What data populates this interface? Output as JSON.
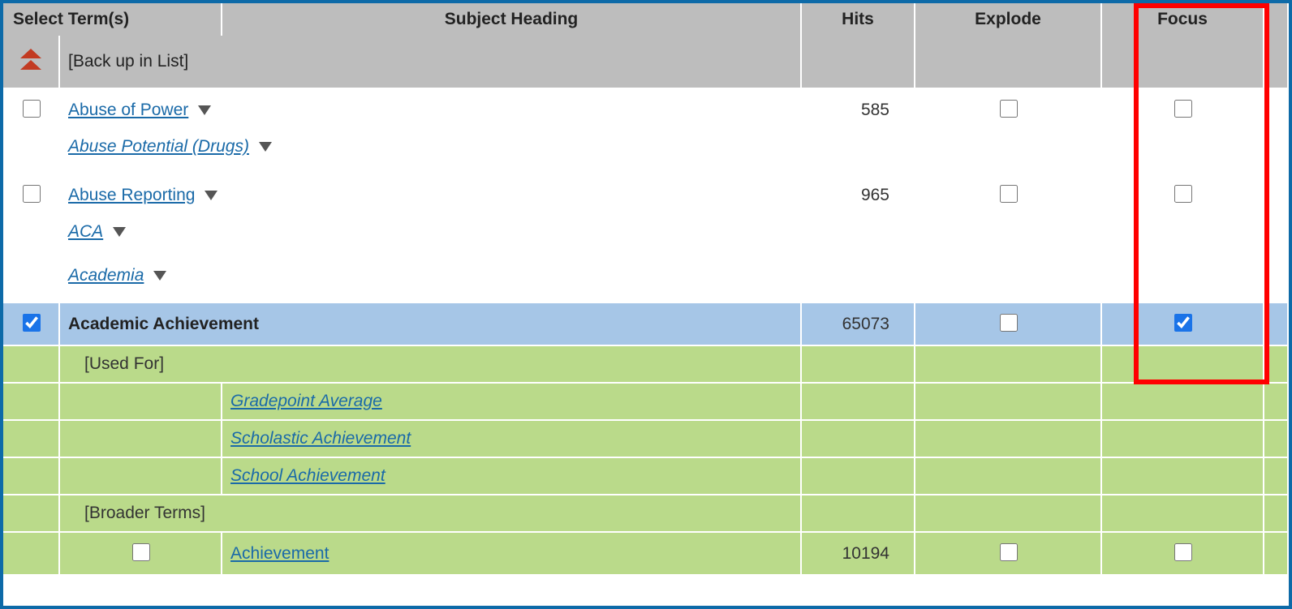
{
  "headers": {
    "select": "Select Term(s)",
    "subject": "Subject Heading",
    "hits": "Hits",
    "explode": "Explode",
    "focus": "Focus"
  },
  "backup_label": "[Back up in List]",
  "terms": {
    "abuse_of_power": {
      "label": "Abuse of Power",
      "hits": "585"
    },
    "abuse_potential": {
      "label": "Abuse Potential (Drugs)"
    },
    "abuse_reporting": {
      "label": "Abuse Reporting",
      "hits": "965"
    },
    "aca": {
      "label": "ACA"
    },
    "academia": {
      "label": "Academia"
    },
    "academic_achievement": {
      "label": "Academic Achievement",
      "hits": "65073"
    }
  },
  "used_for_label": "[Used For]",
  "used_for": {
    "gpa": "Gradepoint Average",
    "scholastic": "Scholastic Achievement",
    "school": "School Achievement"
  },
  "broader_label": "[Broader Terms]",
  "broader": {
    "achievement": {
      "label": "Achievement",
      "hits": "10194"
    }
  }
}
